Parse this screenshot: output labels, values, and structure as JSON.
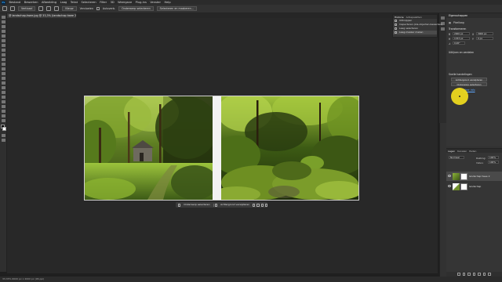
{
  "app": {
    "logo": "Ps",
    "menu": [
      "Bestand",
      "Bewerken",
      "Afbeelding",
      "Laag",
      "Tekst",
      "Selecteren",
      "Filter",
      "3D",
      "Weergave",
      "Plug-ins",
      "Venster",
      "Help"
    ]
  },
  "options_bar": {
    "mode_value": "Verticaal",
    "select_value": "Nieuw",
    "feather_label": "Vervloeien",
    "select_subject_button": "Onderwerp selecteren",
    "select_mask_button": "Selecteren en maskeren...",
    "auto_enhance_label": "Autoverb."
  },
  "document": {
    "tab_title": "@ landschap-twee.jpg @ 33,3% (landschap twee 2, RGB/8) *"
  },
  "history_panel": {
    "tabs": [
      "Historie",
      "Actiepaletten"
    ],
    "rows": [
      {
        "label": "Uitknippen",
        "selected": false
      },
      {
        "label": "Inspecteren (Als-objecten-bewerken)",
        "selected": false
      },
      {
        "label": "Laag selecteren",
        "selected": false
      },
      {
        "label": "Laag-masker maken",
        "selected": true
      }
    ]
  },
  "properties_panel": {
    "tab": "Eigenschappen",
    "layer_kind": "Pixellaag",
    "transform_title": "Transformeren",
    "fields": {
      "w": "2000 px",
      "h": "1333 px",
      "x": "3000 px",
      "y": "0 px",
      "angle": "0,00°"
    },
    "align_title": "Uitlijnen en verdelen",
    "quick_actions_title": "Snelle handelingen",
    "quick_buttons": [
      "Achtergrond verwijderen",
      "Onderwerp selecteren"
    ],
    "more_link": "Meer info"
  },
  "layers_panel": {
    "tabs": [
      "Lagen",
      "Kanalen",
      "Paden"
    ],
    "blend_mode": "Normaal",
    "opacity_label": "Dekking:",
    "opacity_value": "100%",
    "fill_label": "Vullen:",
    "fill_value": "100%",
    "layers": [
      {
        "name": "landschap twee 2",
        "selected": true
      },
      {
        "name": "landschap",
        "selected": false
      }
    ]
  },
  "taskbar": {
    "buttons": [
      "Onderwerp selecteren",
      "Achtergrond verwijderen"
    ]
  },
  "status": {
    "text": "33,33%   6000 px x 2000 px (96 ppi)"
  },
  "colors": {
    "highlight": "#f2dd1d",
    "accent": "#31a8ff",
    "canvas_bg": "#282828"
  }
}
